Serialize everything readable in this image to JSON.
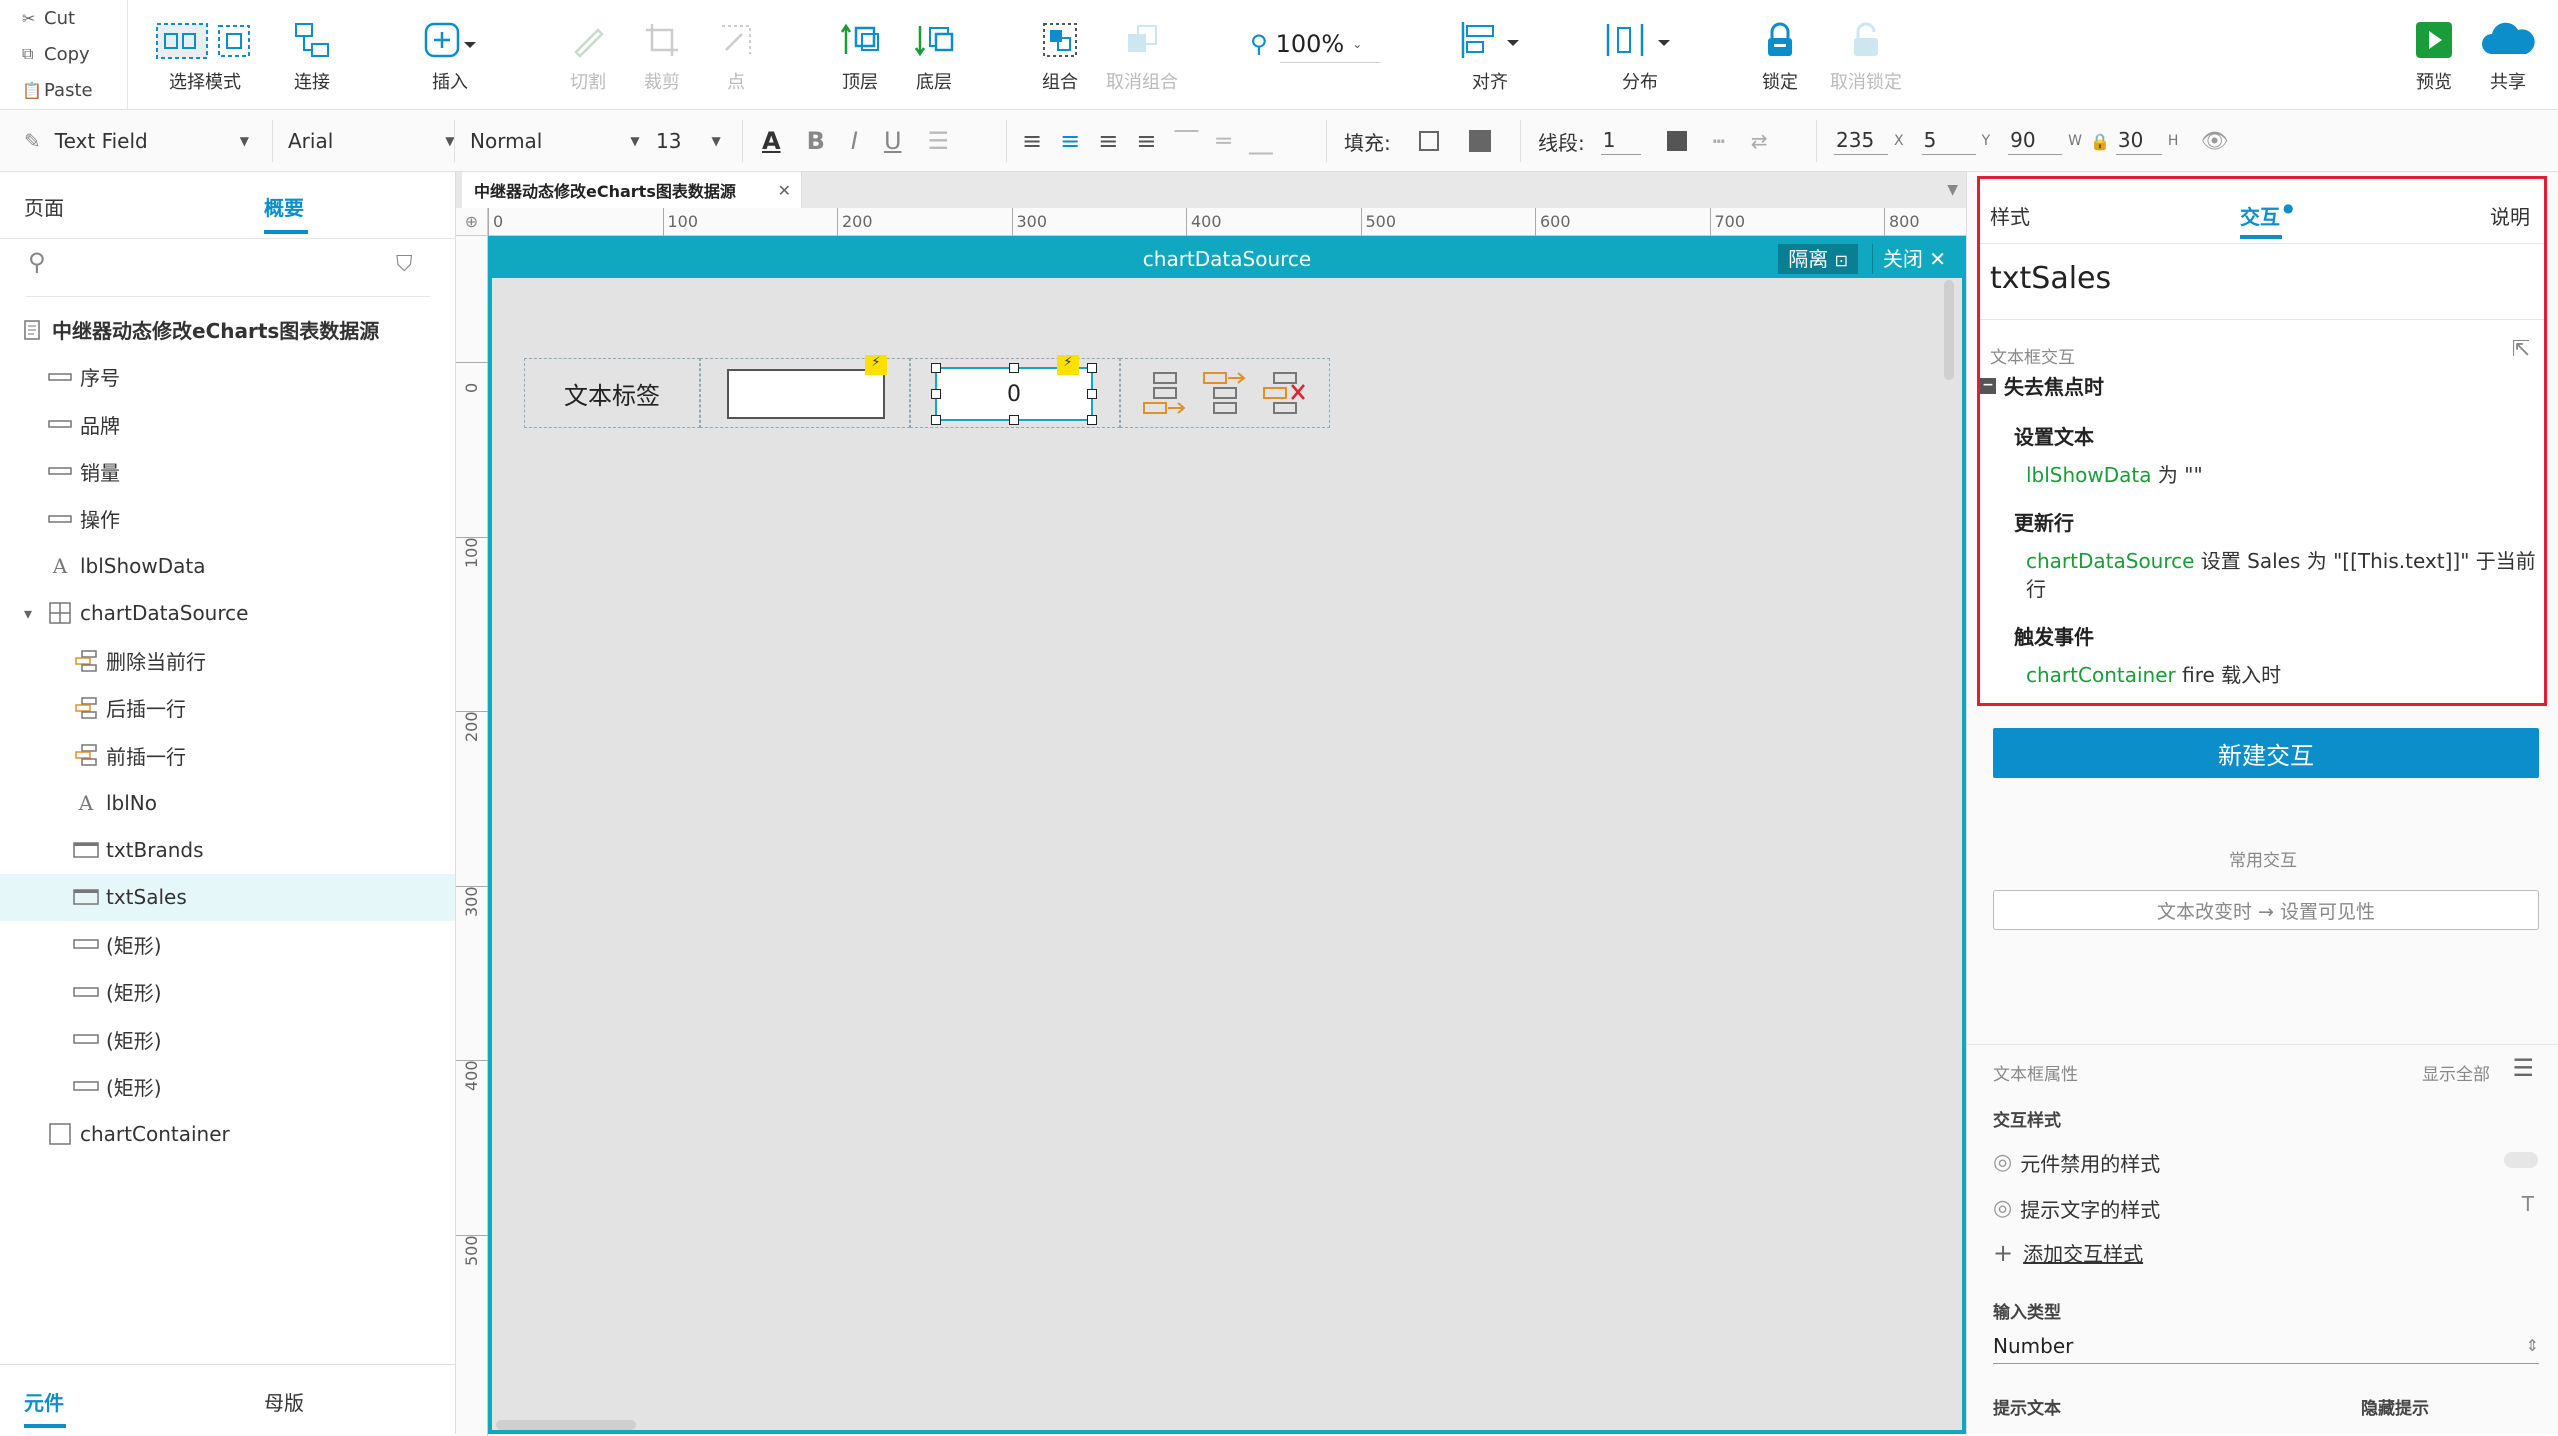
{
  "clipboard": {
    "cut": "Cut",
    "copy": "Copy",
    "paste": "Paste"
  },
  "toolbar": {
    "select_mode": "选择模式",
    "connect": "连接",
    "insert": "插入",
    "cut_shape": "切割",
    "crop": "裁剪",
    "point": "点",
    "bring_front": "顶层",
    "send_back": "底层",
    "group": "组合",
    "ungroup": "取消组合",
    "zoom": "100%",
    "align": "对齐",
    "distribute": "分布",
    "lock": "锁定",
    "unlock": "取消锁定",
    "preview": "预览",
    "share": "共享"
  },
  "format": {
    "widget_type": "Text Field",
    "font": "Arial",
    "style": "Normal",
    "size": "13",
    "fill_label": "填充:",
    "stroke_label": "线段:",
    "stroke_value": "1",
    "x": "235",
    "x_lbl": "X",
    "y": "5",
    "y_lbl": "Y",
    "w": "90",
    "w_lbl": "W",
    "h": "30",
    "h_lbl": "H"
  },
  "left": {
    "tab_pages": "页面",
    "tab_outline": "概要",
    "tree": [
      {
        "label": "中继器动态修改eCharts图表数据源",
        "icon": "page-icon",
        "indent": 0
      },
      {
        "label": "序号",
        "icon": "textfield-icon",
        "indent": 1
      },
      {
        "label": "品牌",
        "icon": "textfield-icon",
        "indent": 1
      },
      {
        "label": "销量",
        "icon": "textfield-icon",
        "indent": 1
      },
      {
        "label": "操作",
        "icon": "textfield-icon",
        "indent": 1
      },
      {
        "label": "lblShowData",
        "icon": "label-icon",
        "indent": 1
      },
      {
        "label": "chartDataSource",
        "icon": "repeater-icon",
        "indent": 1
      },
      {
        "label": "删除当前行",
        "icon": "hotspot-icon",
        "indent": 2
      },
      {
        "label": "后插一行",
        "icon": "hotspot-icon",
        "indent": 2
      },
      {
        "label": "前插一行",
        "icon": "hotspot-icon",
        "indent": 2
      },
      {
        "label": "lblNo",
        "icon": "label-icon",
        "indent": 2
      },
      {
        "label": "txtBrands",
        "icon": "textbox-icon",
        "indent": 2
      },
      {
        "label": "txtSales",
        "icon": "textbox-icon",
        "indent": 2
      },
      {
        "label": "(矩形)",
        "icon": "rect-icon",
        "indent": 2
      },
      {
        "label": "(矩形)",
        "icon": "rect-icon",
        "indent": 2
      },
      {
        "label": "(矩形)",
        "icon": "rect-icon",
        "indent": 2
      },
      {
        "label": "(矩形)",
        "icon": "rect-icon",
        "indent": 2
      },
      {
        "label": "chartContainer",
        "icon": "box-icon",
        "indent": 1
      }
    ],
    "bottom_tab_widgets": "元件",
    "bottom_tab_masters": "母版"
  },
  "canvas": {
    "doc_tab": "中继器动态修改eCharts图表数据源",
    "ruler_h": [
      "0",
      "100",
      "200",
      "300",
      "400",
      "500",
      "600",
      "700",
      "800"
    ],
    "ruler_v": [
      "0",
      "100",
      "200",
      "300",
      "400",
      "500"
    ],
    "master_title": "chartDataSource",
    "isolate": "隔离",
    "close": "关闭",
    "cell_label": "文本标签",
    "cell_value": "0"
  },
  "right": {
    "tab_style": "样式",
    "tab_interaction": "交互",
    "tab_notes": "说明",
    "widget_name": "txtSales",
    "section": "文本框交互",
    "event": "失去焦点时",
    "actions": [
      {
        "title": "设置文本",
        "target": "lblShowData",
        "detail": " 为 \"\""
      },
      {
        "title": "更新行",
        "target": "chartDataSource",
        "detail": " 设置 Sales 为 \"[[This.text]]\" 于当前",
        "detail2": "行"
      },
      {
        "title": "触发事件",
        "target": "chartContainer",
        "detail": " fire 载入时"
      }
    ],
    "new_interaction": "新建交互",
    "common_label": "常用交互",
    "common_item": "文本改变时 → 设置可见性",
    "props_title": "文本框属性",
    "show_all": "显示全部",
    "interaction_styles": "交互样式",
    "disabled_style": "元件禁用的样式",
    "hint_style": "提示文字的样式",
    "add_style": "添加交互样式",
    "input_type_label": "输入类型",
    "input_type": "Number",
    "hint_text_label": "提示文本",
    "hide_hint_label": "隐藏提示"
  },
  "colors": {
    "accent": "#0b8ec9",
    "teal": "#10a8c0",
    "green": "#1a9c3a",
    "highlight": "#e02030"
  }
}
